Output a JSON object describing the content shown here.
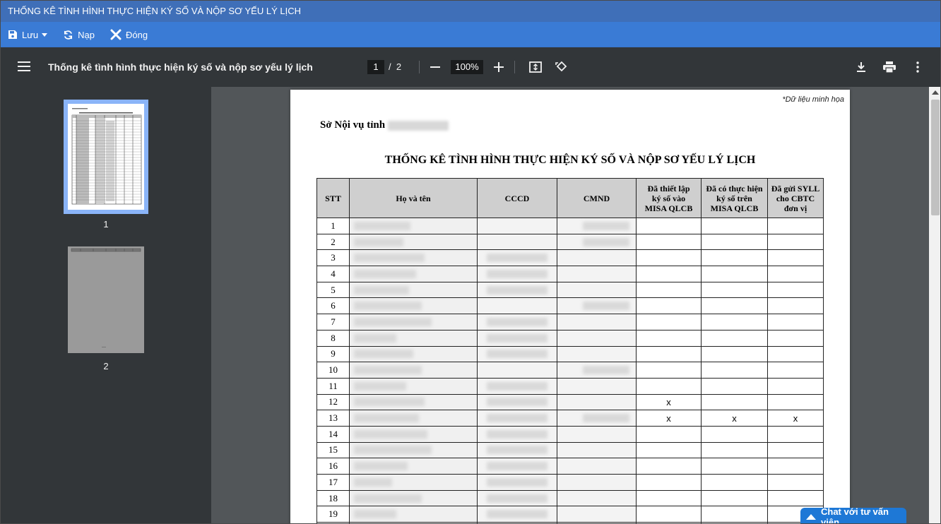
{
  "window": {
    "title": "THỐNG KÊ TÌNH HÌNH THỰC HIỆN KÝ SỐ VÀ NỘP SƠ YẾU LÝ LỊCH"
  },
  "toolbar": {
    "save_label": "Lưu",
    "reload_label": "Nạp",
    "close_label": "Đóng"
  },
  "viewer": {
    "doc_title": "Thống kê tình hình thực hiện ký số và nộp sơ yếu lý lịch",
    "current_page": "1",
    "page_separator": "/",
    "total_pages": "2",
    "zoom": "100%",
    "thumbnails": [
      {
        "label": "1"
      },
      {
        "label": "2"
      }
    ]
  },
  "document": {
    "watermark": "*Dữ liệu minh họa",
    "org_prefix": "Sở Nội vụ tỉnh",
    "title": "THỐNG KÊ TÌNH HÌNH THỰC HIỆN KÝ SỐ VÀ NỘP SƠ YẾU LÝ LỊCH",
    "columns": {
      "stt": "STT",
      "name": "Họ và tên",
      "cccd": "CCCD",
      "cmnd": "CMND",
      "setup": [
        "Đã thiết lập",
        "ký số vào",
        "MISA QLCB"
      ],
      "signed": [
        "Đã có thực hiện",
        "ký số trên",
        "MISA QLCB"
      ],
      "sent": [
        "Đã gửi SYLL",
        "cho CBTC",
        "đơn vị"
      ]
    },
    "rows": [
      {
        "stt": "1",
        "setup": "",
        "signed": "",
        "sent": ""
      },
      {
        "stt": "2",
        "setup": "",
        "signed": "",
        "sent": ""
      },
      {
        "stt": "3",
        "setup": "",
        "signed": "",
        "sent": ""
      },
      {
        "stt": "4",
        "setup": "",
        "signed": "",
        "sent": ""
      },
      {
        "stt": "5",
        "setup": "",
        "signed": "",
        "sent": ""
      },
      {
        "stt": "6",
        "setup": "",
        "signed": "",
        "sent": ""
      },
      {
        "stt": "7",
        "setup": "",
        "signed": "",
        "sent": ""
      },
      {
        "stt": "8",
        "setup": "",
        "signed": "",
        "sent": ""
      },
      {
        "stt": "9",
        "setup": "",
        "signed": "",
        "sent": ""
      },
      {
        "stt": "10",
        "setup": "",
        "signed": "",
        "sent": ""
      },
      {
        "stt": "11",
        "setup": "",
        "signed": "",
        "sent": ""
      },
      {
        "stt": "12",
        "setup": "x",
        "signed": "",
        "sent": ""
      },
      {
        "stt": "13",
        "setup": "x",
        "signed": "x",
        "sent": "x"
      },
      {
        "stt": "14",
        "setup": "",
        "signed": "",
        "sent": ""
      },
      {
        "stt": "15",
        "setup": "",
        "signed": "",
        "sent": ""
      },
      {
        "stt": "16",
        "setup": "",
        "signed": "",
        "sent": ""
      },
      {
        "stt": "17",
        "setup": "",
        "signed": "",
        "sent": ""
      },
      {
        "stt": "18",
        "setup": "",
        "signed": "",
        "sent": ""
      },
      {
        "stt": "19",
        "setup": "",
        "signed": "",
        "sent": ""
      },
      {
        "stt": "",
        "setup": "",
        "signed": "",
        "sent": ""
      }
    ]
  },
  "chat": {
    "label": "Chat với tư vấn viên"
  }
}
